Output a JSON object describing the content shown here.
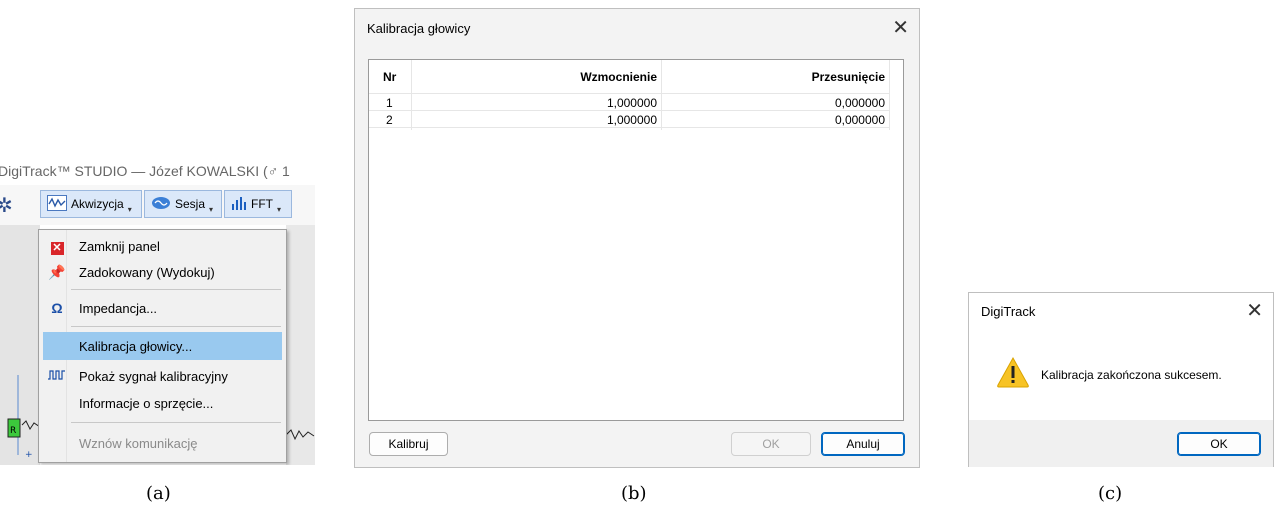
{
  "panel_a": {
    "title": "DigiTrack™ STUDIO — Józef KOWALSKI (♂ 1",
    "toolbar": [
      {
        "label": "Akwizycja",
        "icon": "waveform-icon"
      },
      {
        "label": "Sesja",
        "icon": "brain-icon"
      },
      {
        "label": "FFT",
        "icon": "bar-chart-icon"
      }
    ],
    "menu": {
      "close_panel": "Zamknij panel",
      "docked": "Zadokowany (Wydokuj)",
      "impedance": "Impedancja...",
      "calibration": "Kalibracja głowicy...",
      "show_signal": "Pokaż sygnał kalibracyjny",
      "hw_info": "Informacje o sprzęcie...",
      "resume": "Wznów komunikację"
    },
    "caption": "(a)"
  },
  "panel_b": {
    "title": "Kalibracja głowicy",
    "columns": [
      "Nr",
      "Wzmocnienie",
      "Przesunięcie"
    ],
    "rows": [
      [
        "1",
        "1,000000",
        "0,000000"
      ],
      [
        "2",
        "1,000000",
        "0,000000"
      ]
    ],
    "calibrate_button": "Kalibruj",
    "ok_button": "OK",
    "cancel_button": "Anuluj",
    "caption": "(b)"
  },
  "panel_c": {
    "title": "DigiTrack",
    "message": "Kalibracja zakończona sukcesem.",
    "ok_button": "OK",
    "caption": "(c)"
  }
}
